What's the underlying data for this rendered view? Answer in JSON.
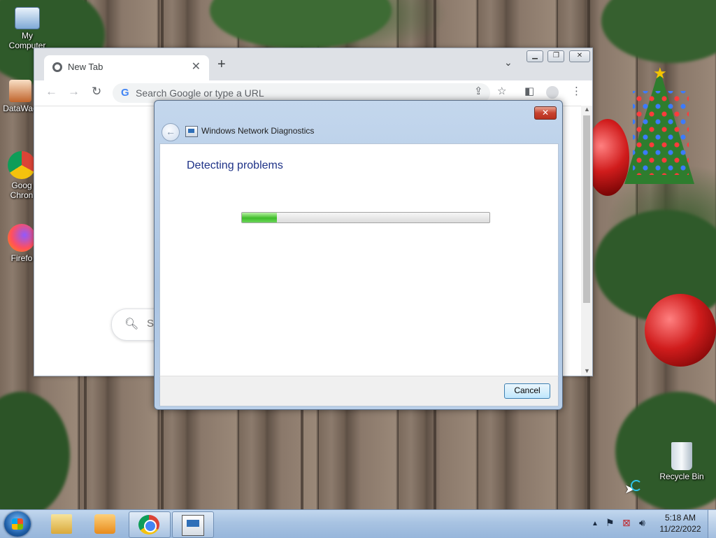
{
  "desktop": {
    "icons": [
      {
        "label": "My Computer",
        "icon": "computer-icon"
      },
      {
        "label": "DataWag",
        "icon": "shortcut-icon"
      },
      {
        "label": "Goog",
        "label2": "Chron",
        "icon": "chrome-icon"
      },
      {
        "label": "Firefo",
        "icon": "firefox-icon"
      },
      {
        "label": "Recycle Bin",
        "icon": "recycle-bin-icon"
      }
    ]
  },
  "browser": {
    "tab_title": "New Tab",
    "omnibox_placeholder": "Search Google or type a URL",
    "search_box_partial": "S"
  },
  "dialog": {
    "title": "Windows Network Diagnostics",
    "heading": "Detecting problems",
    "progress": 0.14,
    "cancel_label": "Cancel",
    "close_glyph": "✕"
  },
  "taskbar": {
    "time": "5:18 AM",
    "date": "11/22/2022",
    "items": [
      "Windows Explorer",
      "Windows Media Player",
      "Google Chrome",
      "Windows Network Diagnostics"
    ]
  },
  "colors": {
    "dialog_heading": "#1e3287",
    "progress_fill": "#3fbd2a",
    "taskbar": "#a8c3e2"
  }
}
